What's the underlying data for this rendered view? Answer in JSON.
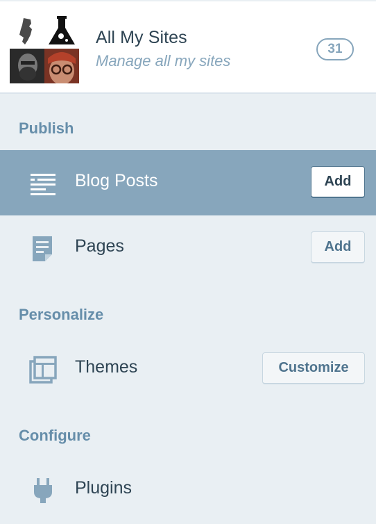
{
  "header": {
    "title": "All My Sites",
    "subtitle": "Manage all my sites",
    "site_count": "31",
    "avatars": [
      "new-jersey-avatar",
      "flask-avatar",
      "bearded-man-avatar",
      "red-hair-glasses-avatar"
    ]
  },
  "sections": {
    "publish": "Publish",
    "personalize": "Personalize",
    "configure": "Configure"
  },
  "menu": {
    "blog_posts": {
      "label": "Blog Posts",
      "action": "Add",
      "icon": "posts-icon",
      "selected": true
    },
    "pages": {
      "label": "Pages",
      "action": "Add",
      "icon": "page-icon"
    },
    "themes": {
      "label": "Themes",
      "action": "Customize",
      "icon": "themes-icon"
    },
    "plugins": {
      "label": "Plugins",
      "icon": "plugin-icon"
    }
  },
  "colors": {
    "background": "#e9eff3",
    "selected_row": "#87a6bc",
    "section_heading": "#668eaa",
    "text": "#2e4453",
    "icon": "#87a6bc"
  }
}
